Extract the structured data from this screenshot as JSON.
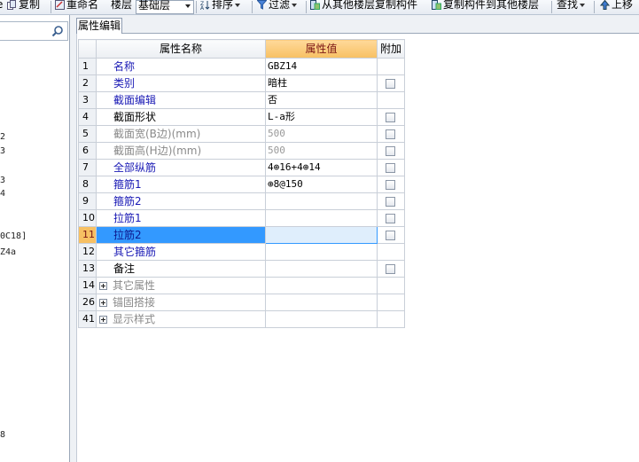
{
  "toolbar": {
    "copy": "复制",
    "rename": "重命名",
    "floor_label": "楼层",
    "floor_value": "基础层",
    "sort": "排序",
    "filter": "过滤",
    "copy_from_other": "从其他楼层复制构件",
    "copy_to_other": "复制构件到其他楼层",
    "find": "查找",
    "move_up": "上移"
  },
  "left_panel": {
    "fragments": [
      "2",
      "3",
      "3",
      "4",
      "0C18]",
      "Z4a",
      "8"
    ]
  },
  "tab": {
    "label": "属性编辑"
  },
  "grid": {
    "headers": {
      "name": "属性名称",
      "value": "属性值",
      "extra": "附加"
    },
    "rows": [
      {
        "num": "1",
        "name": "名称",
        "value": "GBZ14",
        "checkbox": false
      },
      {
        "num": "2",
        "name": "类别",
        "value": "暗柱",
        "checkbox": true
      },
      {
        "num": "3",
        "name": "截面编辑",
        "value": "否",
        "checkbox": false
      },
      {
        "num": "4",
        "name": "截面形状",
        "value": "L-a形",
        "checkbox": true
      },
      {
        "num": "5",
        "name": "截面宽(B边)(mm)",
        "value": "500",
        "checkbox": true
      },
      {
        "num": "6",
        "name": "截面高(H边)(mm)",
        "value": "500",
        "checkbox": true
      },
      {
        "num": "7",
        "name": "全部纵筋",
        "value": "4⊕16+4⊕14",
        "checkbox": true
      },
      {
        "num": "8",
        "name": "箍筋1",
        "value": "⊕8@150",
        "checkbox": true
      },
      {
        "num": "9",
        "name": "箍筋2",
        "value": "",
        "checkbox": true
      },
      {
        "num": "10",
        "name": "拉筋1",
        "value": "",
        "checkbox": true
      },
      {
        "num": "11",
        "name": "拉筋2",
        "value": "",
        "checkbox": true
      },
      {
        "num": "12",
        "name": "其它箍筋",
        "value": "",
        "checkbox": false
      },
      {
        "num": "13",
        "name": "备注",
        "value": "",
        "checkbox": true
      },
      {
        "num": "14",
        "name": "其它属性",
        "value": "",
        "checkbox": false
      },
      {
        "num": "26",
        "name": "锚固搭接",
        "value": "",
        "checkbox": false
      },
      {
        "num": "41",
        "name": "显示样式",
        "value": "",
        "checkbox": false
      }
    ]
  },
  "colors": {
    "blue_text": "#1a1ab5",
    "selection": "#3399ff",
    "header_orange": "#f7c063"
  }
}
